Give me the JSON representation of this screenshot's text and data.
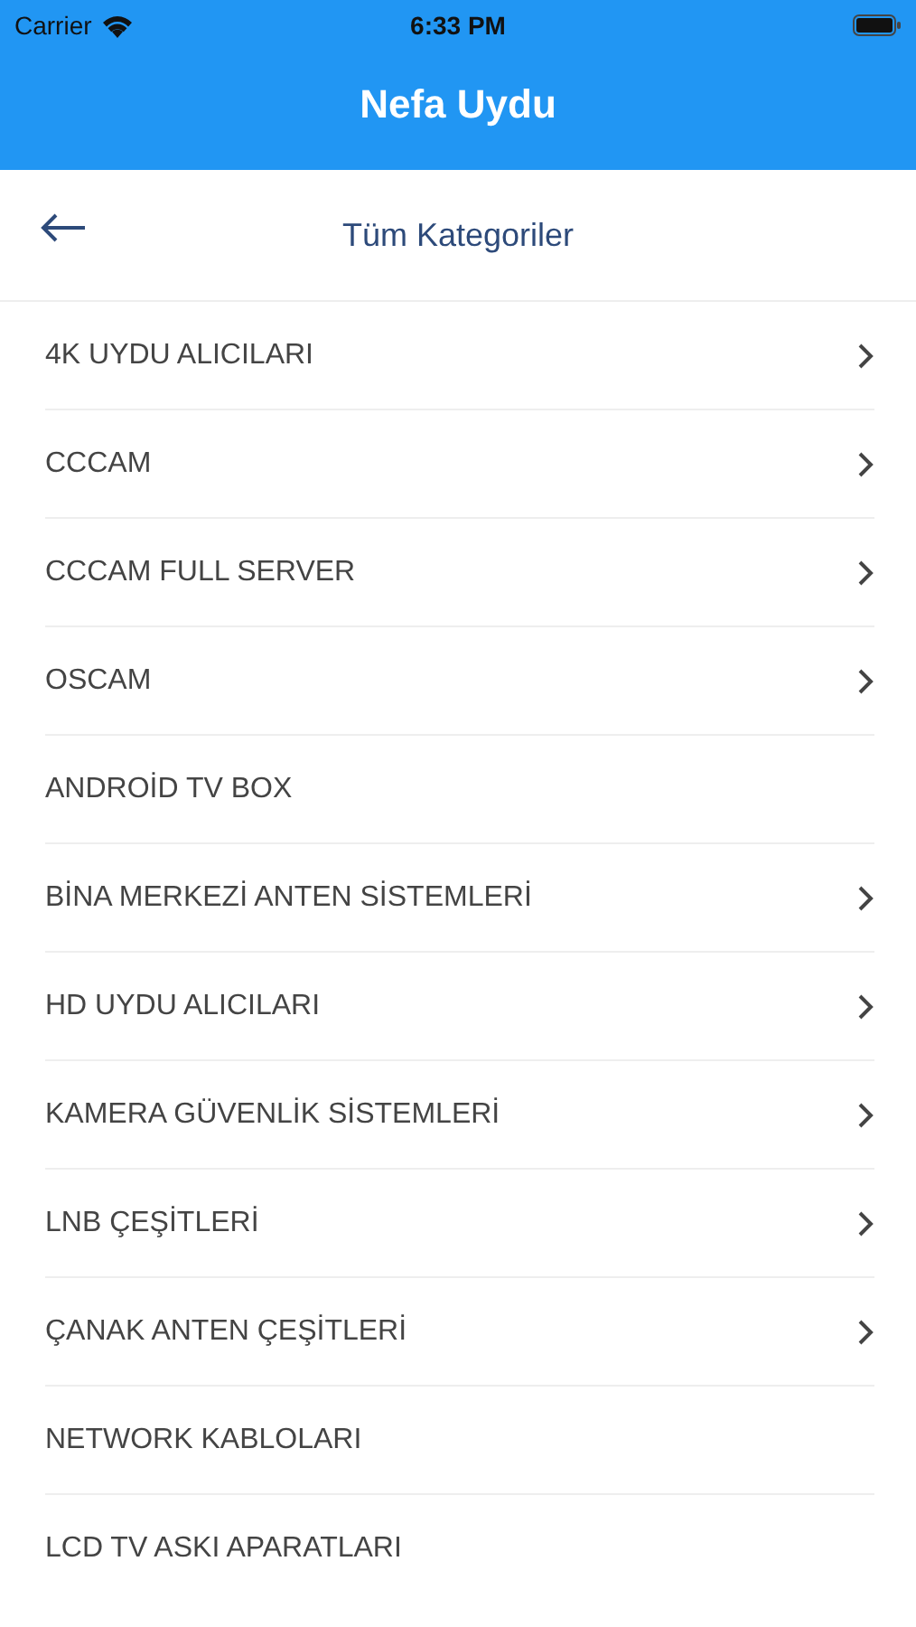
{
  "status_bar": {
    "carrier": "Carrier",
    "time": "6:33 PM"
  },
  "header": {
    "title": "Nefa Uydu"
  },
  "subheader": {
    "title": "Tüm Kategoriler"
  },
  "categories": [
    {
      "label": "4K UYDU ALICILARI",
      "has_children": true
    },
    {
      "label": "CCCAM",
      "has_children": true
    },
    {
      "label": "CCCAM FULL SERVER",
      "has_children": true
    },
    {
      "label": "OSCAM",
      "has_children": true
    },
    {
      "label": "ANDROİD TV BOX",
      "has_children": false
    },
    {
      "label": "BİNA MERKEZİ ANTEN SİSTEMLERİ",
      "has_children": true
    },
    {
      "label": "HD UYDU ALICILARI",
      "has_children": true
    },
    {
      "label": "KAMERA GÜVENLİK SİSTEMLERİ",
      "has_children": true
    },
    {
      "label": "LNB ÇEŞİTLERİ",
      "has_children": true
    },
    {
      "label": "ÇANAK ANTEN ÇEŞİTLERİ",
      "has_children": true
    },
    {
      "label": "NETWORK KABLOLARI",
      "has_children": false
    },
    {
      "label": "LCD TV ASKI APARATLARI",
      "has_children": false
    }
  ]
}
